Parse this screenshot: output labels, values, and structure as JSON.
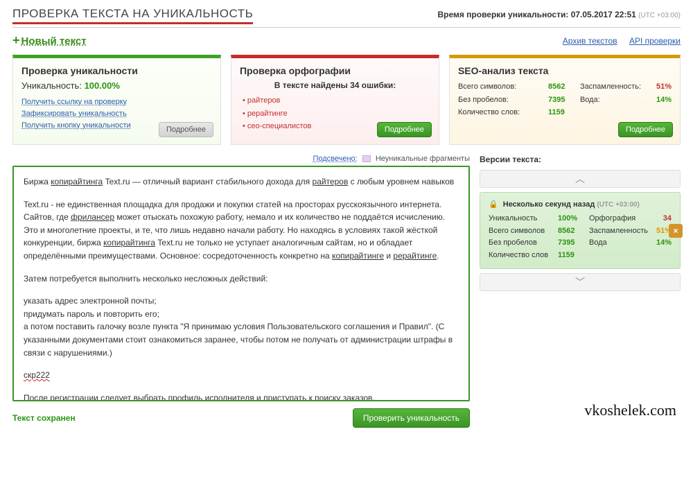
{
  "header": {
    "title": "ПРОВЕРКА ТЕКСТА НА УНИКАЛЬНОСТЬ",
    "time_label": "Время проверки уникальности:",
    "time_value": "07.05.2017 22:51",
    "utc": "(UTC +03:00)"
  },
  "top": {
    "new_text": "Новый текст",
    "archive": "Архив текстов",
    "api": "API проверки"
  },
  "panel_uniq": {
    "title": "Проверка уникальности",
    "label": "Уникальность:",
    "value": "100.00%",
    "links": [
      "Получить ссылку на проверку",
      "Зафиксировать уникальность",
      "Получить кнопку уникальности"
    ],
    "more": "Подробнее"
  },
  "panel_spell": {
    "title": "Проверка орфографии",
    "subtitle": "В тексте найдены 34 ошибки:",
    "items": [
      "райтеров",
      "рерайтинге",
      "сео-специалистов"
    ],
    "more": "Подробнее"
  },
  "panel_seo": {
    "title": "SEO-анализ текста",
    "rows": [
      {
        "l1": "Всего символов:",
        "v1": "8562",
        "l2": "Заспамленность:",
        "v2": "51%",
        "cls": "c-red"
      },
      {
        "l1": "Без пробелов:",
        "v1": "7395",
        "l2": "Вода:",
        "v2": "14%",
        "cls": "c-green"
      },
      {
        "l1": "Количество слов:",
        "v1": "1159",
        "l2": "",
        "v2": "",
        "cls": ""
      }
    ],
    "more": "Подробнее"
  },
  "legend": {
    "link": "Подсвечено:",
    "label": "Неуникальные фрагменты"
  },
  "text": {
    "p1a": "Биржа ",
    "p1b": "копирайтинга",
    "p1c": " Text.ru — отличный вариант стабильного дохода для ",
    "p1d": "райтеров",
    "p1e": " с любым уровнем навыков",
    "p2a": "Text.ru - не единственная площадка для продажи и покупки статей на просторах русскоязычного интернета. Сайтов, где ",
    "p2b": "фрилансер",
    "p2c": " может отыскать похожую работу, немало и их количество не поддаётся исчислению. Это и многолетние проекты, и те, что лишь недавно начали работу. Но находясь в условиях такой жёсткой конкуренции, биржа ",
    "p2d": "копирайтинга",
    "p2e": " Text.ru не только не уступает аналогичным сайтам, но и обладает определёнными преимуществами. Основное: сосредоточенность конкретно на ",
    "p2f": "копирайтинге",
    "p2g": " и ",
    "p2h": "рерайтинге",
    "p2i": ".",
    "p3": "Затем потребуется выполнить несколько несложных действий:",
    "p4": "указать адрес электронной почты;\nпридумать пароль и повторить его;\nа потом поставить галочку возле пункта \"Я принимаю условия Пользовательского соглашения и Правил\". (С указанными документами стоит ознакомиться заранее, чтобы потом не получать от администрации штрафы в связи с нарушениями.)",
    "p5": "скр222",
    "p6": "После регистрации следует выбрать профиль исполнителя и приступать к поиску заказов."
  },
  "bottom": {
    "saved": "Текст сохранен",
    "check": "Проверить уникальность"
  },
  "versions": {
    "title": "Версии текста:",
    "card": {
      "title": "Несколько секунд назад",
      "utc": "(UTC +03:00)",
      "rows": [
        {
          "l1": "Уникальность",
          "v1": "100%",
          "c1": "c-green",
          "l2": "Орфография",
          "v2": "34",
          "c2": "c-red"
        },
        {
          "l1": "Всего символов",
          "v1": "8562",
          "c1": "c-green",
          "l2": "Заспамленность",
          "v2": "51%",
          "c2": "c-orange"
        },
        {
          "l1": "Без пробелов",
          "v1": "7395",
          "c1": "c-green",
          "l2": "Вода",
          "v2": "14%",
          "c2": "c-green"
        },
        {
          "l1": "Количество слов",
          "v1": "1159",
          "c1": "c-green",
          "l2": "",
          "v2": "",
          "c2": ""
        }
      ]
    }
  },
  "watermark": "vkoshelek.com"
}
